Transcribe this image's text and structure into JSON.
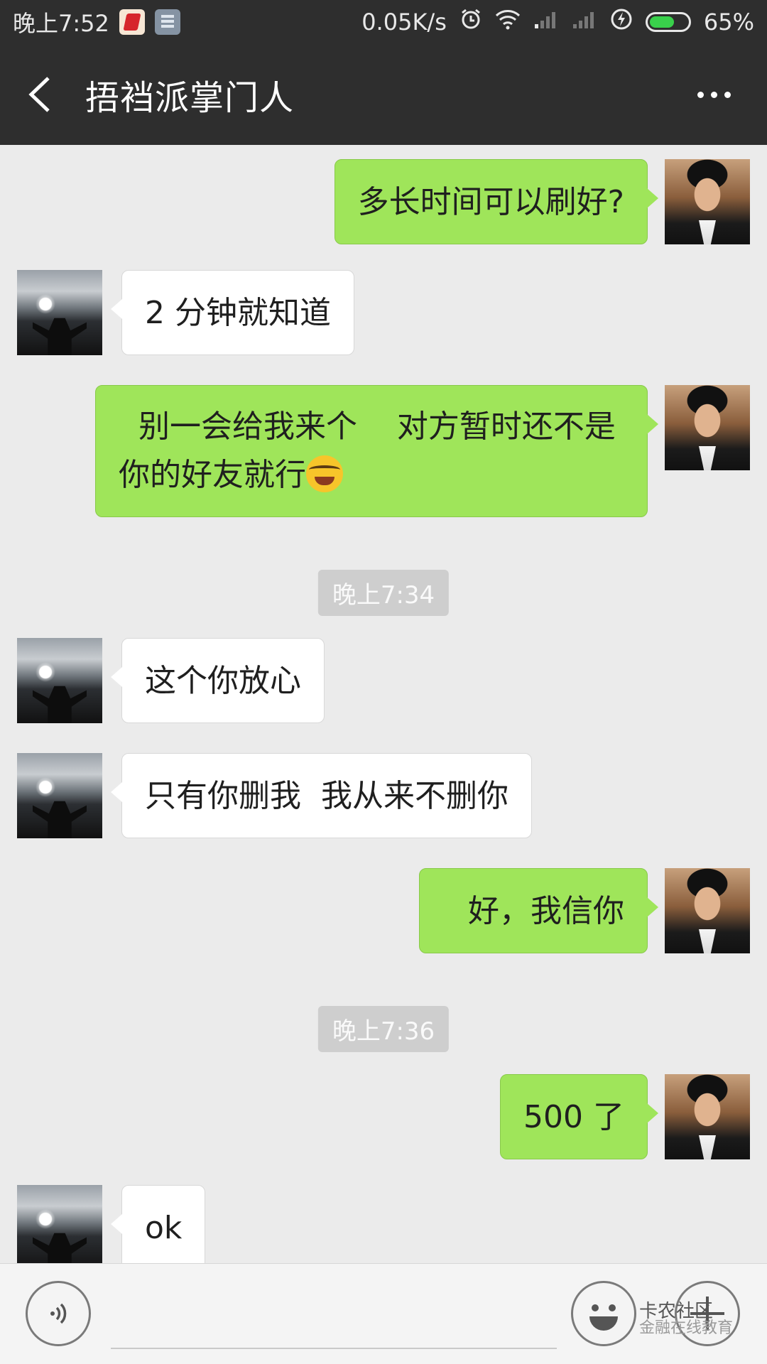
{
  "status_bar": {
    "time": "晚上7:52",
    "net_speed": "0.05K/s",
    "battery": "65%",
    "battery_level_percent": 65,
    "icons": [
      "app-notification-icon",
      "message-notification-icon",
      "alarm-icon",
      "wifi-icon",
      "signal-icon",
      "signal-icon",
      "charging-icon",
      "battery-icon"
    ]
  },
  "header": {
    "title": "捂裆派掌门人",
    "back_icon": "back-chevron-icon",
    "more_icon": "more-dots-icon"
  },
  "messages": [
    {
      "sender": "me",
      "text": "多长时间可以刷好?"
    },
    {
      "sender": "them",
      "text": "2 分钟就知道"
    },
    {
      "sender": "me",
      "text": "  别一会给我来个    对方暂时还不是你的好友就行",
      "emoji": "laughing-crying-emoji"
    },
    {
      "type": "timestamp",
      "text": "晚上7:34"
    },
    {
      "sender": "them",
      "text": "这个你放心"
    },
    {
      "sender": "them",
      "text": "只有你删我  我从来不删你"
    },
    {
      "sender": "me",
      "text": "好，我信你"
    },
    {
      "type": "timestamp",
      "text": "晚上7:36"
    },
    {
      "sender": "me",
      "text": "500 了"
    },
    {
      "sender": "them",
      "text": "ok"
    }
  ],
  "input_bar": {
    "voice_icon": "voice-icon",
    "emoji_icon": "emoji-face-icon",
    "plus_icon": "plus-icon",
    "text": ""
  },
  "watermark": {
    "line1": "卡农社区",
    "line2": "金融在线教育"
  },
  "colors": {
    "bar_dark": "#2e2e2e",
    "chat_bg": "#ebebeb",
    "my_bubble": "#9fe55a",
    "their_bubble": "#ffffff",
    "timestamp_bg": "#cecece"
  }
}
